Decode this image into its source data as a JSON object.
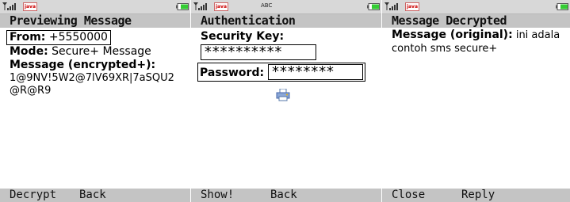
{
  "colors": {
    "bar": "#c4c4c4",
    "status": "#d8d8d8",
    "battery": "#33cc33"
  },
  "screens": [
    {
      "status": {
        "java_badge": "java",
        "mode": ""
      },
      "title": "Previewing Message",
      "from_label": "From:",
      "from_value": "+5550000",
      "mode_label": "Mode:",
      "mode_value": "Secure+ Message",
      "message_label": "Message (encrypted+):",
      "message_value": "1@9NV!5W2@7lV69XR|7aSQU2@R@R9",
      "softkeys": {
        "left": "Decrypt",
        "right": "Back"
      }
    },
    {
      "status": {
        "java_badge": "java",
        "mode": "ABC"
      },
      "title": "Authentication",
      "security_key_label": "Security Key:",
      "security_key_value": "**********",
      "password_label": "Password:",
      "password_value": "********",
      "icon": "printer-icon",
      "softkeys": {
        "left": "Show!",
        "right": "Back"
      }
    },
    {
      "status": {
        "java_badge": "java",
        "mode": ""
      },
      "title": "Message Decrypted",
      "original_label": "Message (original):",
      "original_value": "ini adala contoh sms secure+",
      "softkeys": {
        "left": "Close",
        "right": "Reply"
      }
    }
  ]
}
